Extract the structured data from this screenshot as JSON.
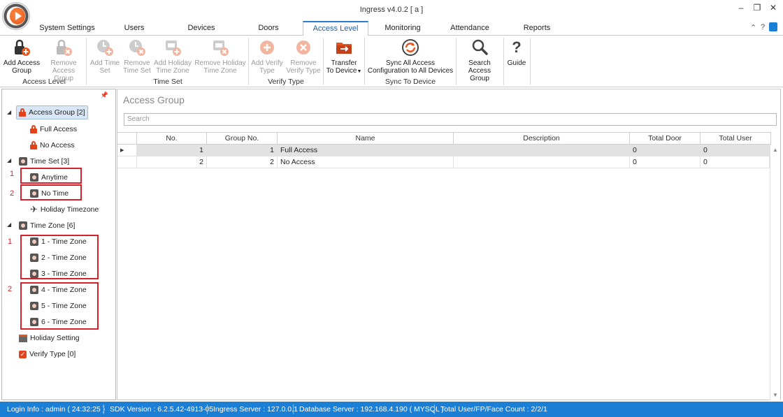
{
  "window": {
    "title": "Ingress v4.0.2 [ a ]"
  },
  "tabs": [
    {
      "label": "System Settings"
    },
    {
      "label": "Users"
    },
    {
      "label": "Devices"
    },
    {
      "label": "Doors"
    },
    {
      "label": "Access Level",
      "active": true
    },
    {
      "label": "Monitoring"
    },
    {
      "label": "Attendance"
    },
    {
      "label": "Reports"
    }
  ],
  "ribbon": {
    "access_level": {
      "group_label": "Access Level",
      "add_access_group": {
        "line1": "Add Access",
        "line2": "Group"
      },
      "remove_access_group": {
        "line1": "Remove",
        "line2": "Access Group"
      }
    },
    "time_set": {
      "group_label": "Time Set",
      "add_time_set": {
        "line1": "Add Time",
        "line2": "Set"
      },
      "remove_time_set": {
        "line1": "Remove",
        "line2": "Time Set"
      },
      "add_holiday_time_zone": {
        "line1": "Add Holiday",
        "line2": "Time Zone"
      },
      "remove_holiday_time_zone": {
        "line1": "Remove Holiday",
        "line2": "Time Zone"
      }
    },
    "verify_type": {
      "group_label": "Verify Type",
      "add_verify_type": {
        "line1": "Add Verify",
        "line2": "Type"
      },
      "remove_verify_type": {
        "line1": "Remove",
        "line2": "Verify Type"
      }
    },
    "transfer": {
      "line1": "Transfer",
      "line2": "To Device"
    },
    "sync": {
      "group_label": "Sync To Device",
      "sync_all": {
        "line1": "Sync All Access",
        "line2": "Configuration to All Devices"
      }
    },
    "search_access_group": {
      "line1": "Search",
      "line2": "Access Group"
    },
    "guide": {
      "label": "Guide"
    }
  },
  "tree": {
    "access_group": "Access Group [2]",
    "full_access": "Full Access",
    "no_access": "No Access",
    "time_set": "Time Set [3]",
    "anytime": "Anytime",
    "no_time": "No Time",
    "holiday_timezone": "Holiday Timezone",
    "time_zone": "Time Zone [6]",
    "tz1": "1 - Time Zone",
    "tz2": "2 - Time Zone",
    "tz3": "3 - Time Zone",
    "tz4": "4 - Time Zone",
    "tz5": "5 - Time Zone",
    "tz6": "6 - Time Zone",
    "holiday_setting": "Holiday Setting",
    "verify_type": "Verify Type [0]"
  },
  "annotations": {
    "ts_1": "1",
    "ts_2": "2",
    "tz_1": "1",
    "tz_2": "2"
  },
  "main": {
    "title": "Access Group",
    "search_placeholder": "Search",
    "columns": [
      "No.",
      "Group No.",
      "Name",
      "Description",
      "Total Door",
      "Total User"
    ],
    "rows": [
      {
        "no": "1",
        "group_no": "1",
        "name": "Full Access",
        "description": "",
        "total_door": "0",
        "total_user": "0"
      },
      {
        "no": "2",
        "group_no": "2",
        "name": "No Access",
        "description": "",
        "total_door": "0",
        "total_user": "0"
      }
    ]
  },
  "status": {
    "login": "Login Info : admin ( 24:32:25 )",
    "sdk": "SDK Version : 6.2.5.42-4913-05",
    "ingress_server": "Ingress Server : 127.0.0.1",
    "database_server": "Database Server : 192.168.4.190 ( MYSQL )",
    "total": "Total User/FP/Face Count : 2/2/1"
  },
  "colors": {
    "accent": "#1c7fd6",
    "annotation": "#d6202a",
    "brand": "#e4541b"
  }
}
